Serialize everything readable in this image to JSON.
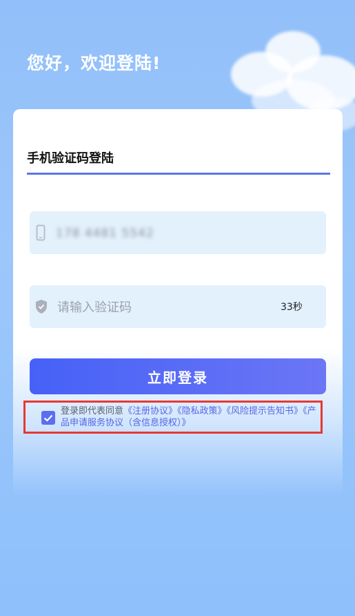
{
  "greeting": "您好，欢迎登陆!",
  "login_tab": {
    "title": "手机验证码登陆"
  },
  "phone_field": {
    "icon": "phone-icon",
    "value": "178 4481 5542"
  },
  "code_field": {
    "icon": "shield-icon",
    "placeholder": "请输入验证码",
    "countdown": "33秒"
  },
  "login_button": {
    "label": "立即登录"
  },
  "agreement": {
    "checked": true,
    "prefix": "登录即代表同意",
    "links": [
      "《注册协议》",
      "《隐私政策》",
      "《风险提示告知书》",
      "《产品申请服务协议（含信息授权）》"
    ]
  },
  "colors": {
    "accent": "#5b6ef0",
    "button_start": "#4661f7",
    "button_end": "#6b76f5",
    "highlight_border": "#e53935",
    "input_bg": "#e3f1fd",
    "background": "#92bff9"
  }
}
